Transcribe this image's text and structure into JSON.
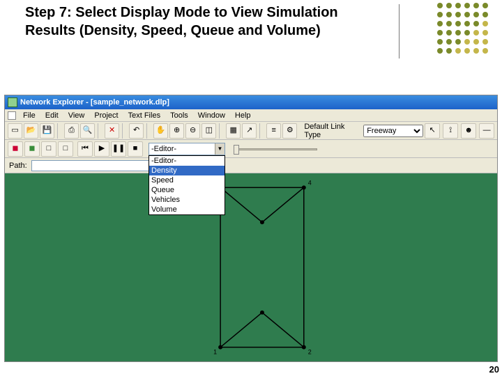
{
  "slide": {
    "heading": "Step 7: Select Display Mode to View Simulation Results (Density, Speed, Queue and Volume)",
    "page_number": "20"
  },
  "window": {
    "title": "Network Explorer - [sample_network.dlp]"
  },
  "menubar": {
    "items": [
      "File",
      "Edit",
      "View",
      "Project",
      "Text Files",
      "Tools",
      "Window",
      "Help"
    ]
  },
  "toolbar1": {
    "default_link_label": "Default Link Type",
    "default_link_value": "Freeway",
    "link_options": [
      "Freeway"
    ]
  },
  "toolbar2": {
    "combo_value": "-Editor-",
    "dropdown_items": [
      "-Editor-",
      "Density",
      "Speed",
      "Queue",
      "Vehicles",
      "Volume"
    ],
    "highlight_index": 1
  },
  "pathrow": {
    "label": "Path:",
    "value": ""
  },
  "icons": {
    "new": "▭",
    "open": "📂",
    "save": "💾",
    "print": "⎙",
    "search": "🔍",
    "delete": "✕",
    "undo": "↶",
    "hand": "✋",
    "zoomin": "⊕",
    "zoomout": "⊖",
    "fit": "◫",
    "grid": "▦",
    "tree": "≡",
    "arrow": "↗",
    "line": "—",
    "node": "●",
    "rewind": "⏮",
    "play": "▶",
    "pause": "❚❚",
    "stop": "■",
    "pointer": "↖",
    "measure": "⟟",
    "user": "☻",
    "run": "▶",
    "cfg": "⚙",
    "red": "◼",
    "grn": "◼",
    "blank": "□"
  }
}
